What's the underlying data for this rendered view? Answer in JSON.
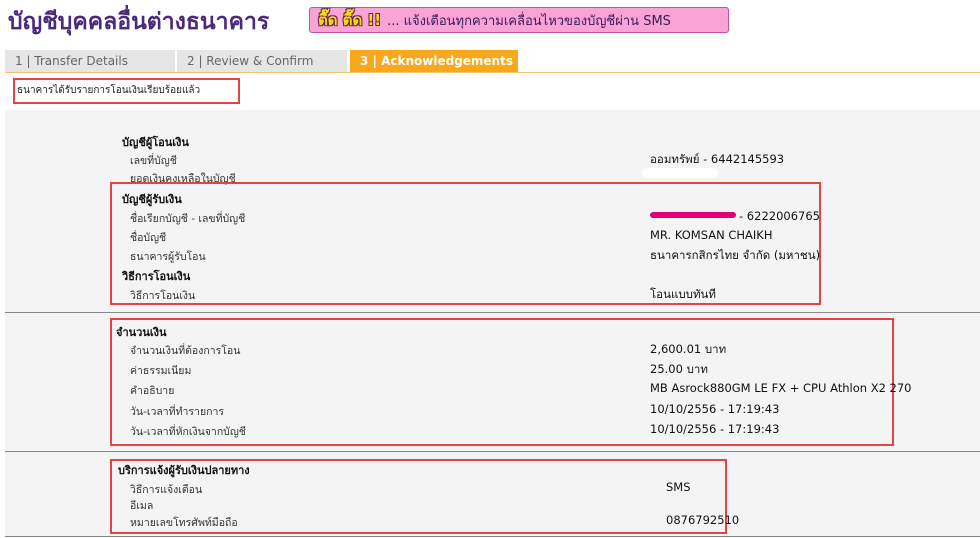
{
  "header": {
    "title": "บัญชีบุคคลอื่นต่างธนาคาร",
    "promo_badge": "ตื๊ด ตื๊ด !!",
    "promo_text": "... แจ้งเตือนทุกความเคลื่อนไหวของบัญชีผ่าน SMS"
  },
  "tabs": [
    {
      "label": "1 | Transfer Details"
    },
    {
      "label": "2 | Review & Confirm"
    },
    {
      "label": "3 | Acknowledgements"
    }
  ],
  "status_message": "ธนาคารได้รับรายการโอนเงินเรียบร้อยแล้ว",
  "from_account": {
    "title": "บัญชีผู้โอนเงิน",
    "rows": [
      {
        "label": "เลขที่บัญชี",
        "value": "ออมทรัพย์ - 6442145593"
      },
      {
        "label": "ยอดเงินคงเหลือในบัญชี",
        "value": ""
      }
    ]
  },
  "to_account": {
    "title": "บัญชีผู้รับเงิน",
    "rows": [
      {
        "label": "ชื่อเรียกบัญชี - เลขที่บัญชี",
        "value": "- 6222006765"
      },
      {
        "label": "ชื่อบัญชี",
        "value": "MR. KOMSAN CHAIKH"
      },
      {
        "label": "ธนาคารผู้รับโอน",
        "value": "ธนาคารกสิกรไทย จำกัด (มหาชน)"
      }
    ]
  },
  "method": {
    "title": "วิธีการโอนเงิน",
    "rows": [
      {
        "label": "วิธีการโอนเงิน",
        "value": "โอนแบบทันที"
      }
    ]
  },
  "amount": {
    "title": "จำนวนเงิน",
    "rows": [
      {
        "label": "จำนวนเงินที่ต้องการโอน",
        "value": "2,600.01 บาท"
      },
      {
        "label": "ค่าธรรมเนียม",
        "value": "25.00  บาท"
      },
      {
        "label": "คำอธิบาย",
        "value": "MB Asrock880GM LE FX + CPU Athlon X2 270"
      },
      {
        "label": "วัน-เวลาที่ทำรายการ",
        "value": "10/10/2556 - 17:19:43"
      },
      {
        "label": "วัน-เวลาที่หักเงินจากบัญชี",
        "value": "10/10/2556 - 17:19:43"
      }
    ]
  },
  "notify": {
    "title": "บริการแจ้งผู้รับเงินปลายทาง",
    "rows": [
      {
        "label": "วิธีการแจ้งเตือน",
        "value": "SMS"
      },
      {
        "label": "อีเมล",
        "value": ""
      },
      {
        "label": "หมายเลขโทรศัพท์มือถือ",
        "value": "0876792510"
      }
    ]
  },
  "colors": {
    "title": "#4b2a7c",
    "active_tab": "#f7a81c",
    "highlight_box": "#e04545",
    "promo_bg": "#f9a3d7"
  }
}
